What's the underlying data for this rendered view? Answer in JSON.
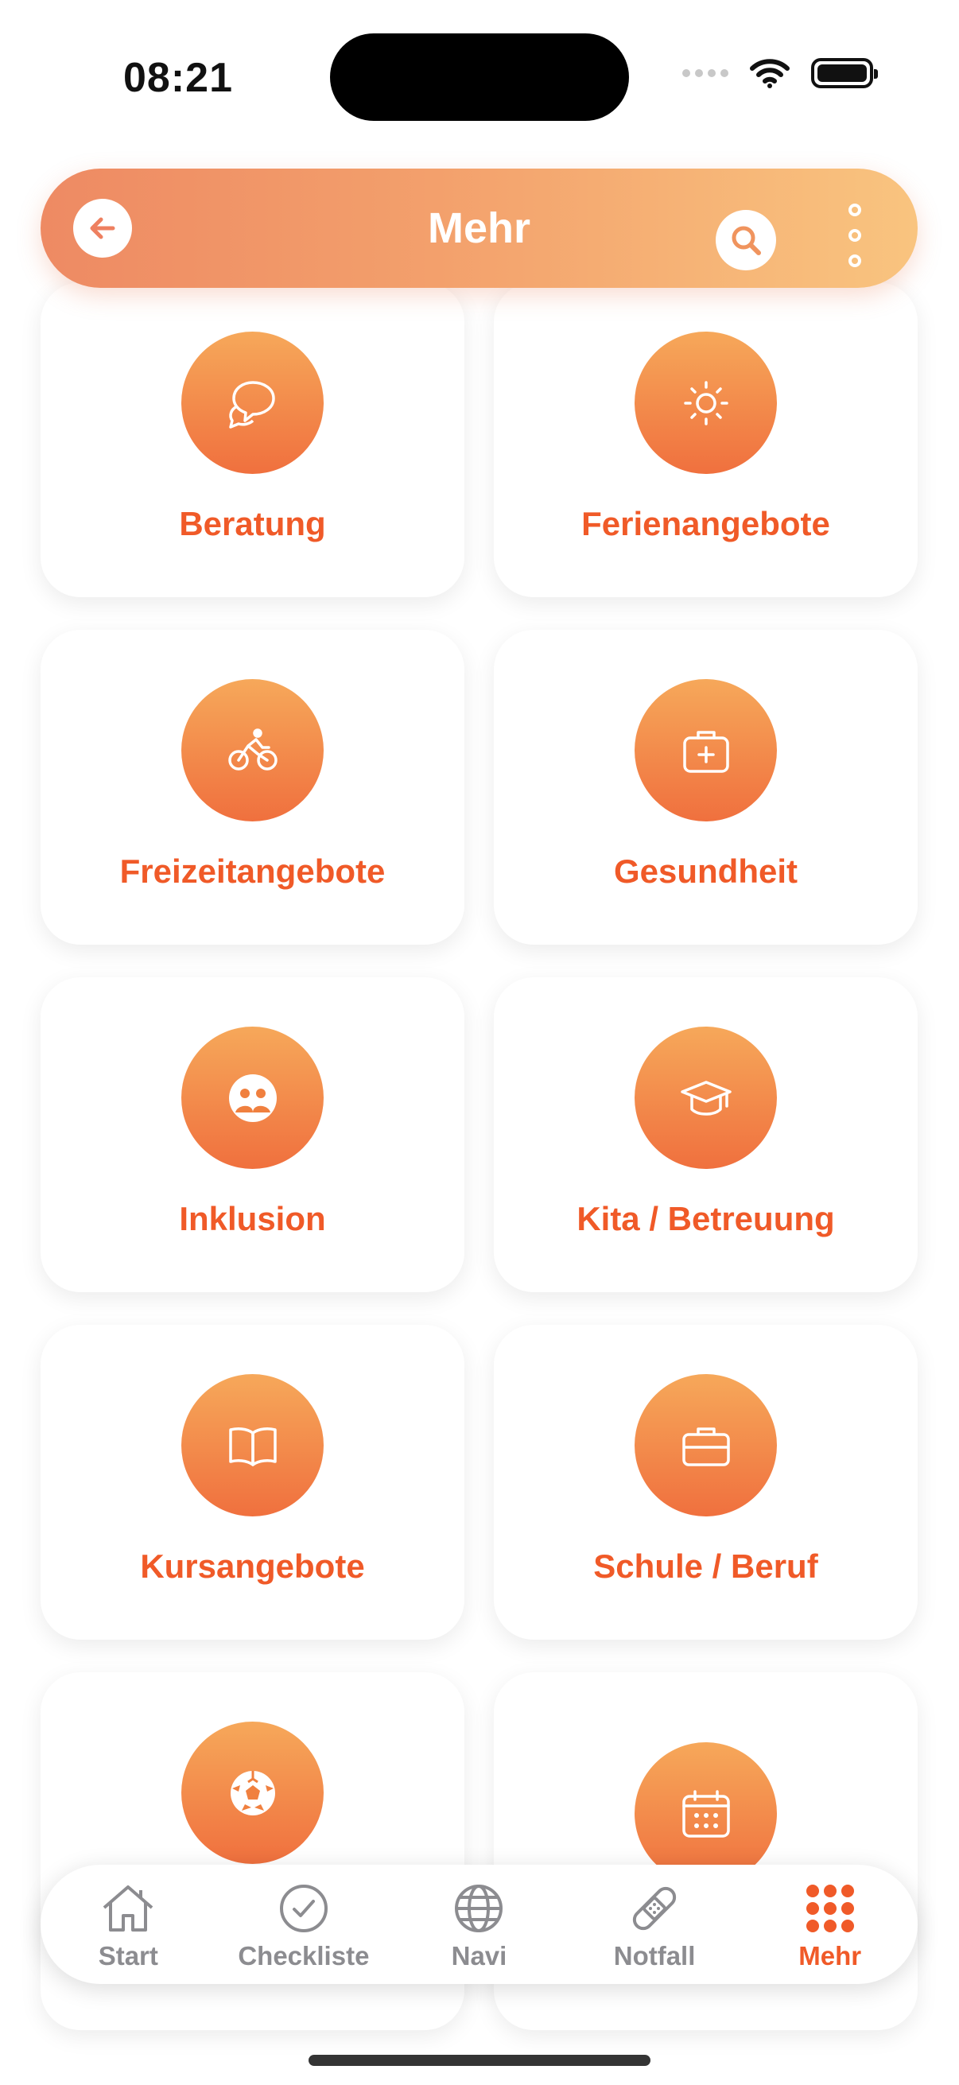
{
  "status_bar": {
    "time": "08:21"
  },
  "header": {
    "title": "Mehr"
  },
  "tiles": [
    {
      "label": "Beratung",
      "icon": "chat-bubbles-icon"
    },
    {
      "label": "Ferienangebote",
      "icon": "sun-icon"
    },
    {
      "label": "Freizeitangebote",
      "icon": "bicycle-icon"
    },
    {
      "label": "Gesundheit",
      "icon": "first-aid-kit-icon"
    },
    {
      "label": "Inklusion",
      "icon": "people-circle-icon"
    },
    {
      "label": "Kita / Betreuung",
      "icon": "graduation-cap-icon"
    },
    {
      "label": "Kursangebote",
      "icon": "open-book-icon"
    },
    {
      "label": "Schule / Beruf",
      "icon": "briefcase-icon"
    },
    {
      "label": "",
      "icon": "soccer-ball-icon"
    },
    {
      "label": "",
      "icon": "calendar-icon"
    }
  ],
  "tabbar": {
    "items": [
      {
        "label": "Start",
        "icon": "home-icon",
        "active": false
      },
      {
        "label": "Checkliste",
        "icon": "checkmark-circle-icon",
        "active": false
      },
      {
        "label": "Navi",
        "icon": "globe-icon",
        "active": false
      },
      {
        "label": "Notfall",
        "icon": "bandage-icon",
        "active": false
      },
      {
        "label": "Mehr",
        "icon": "grid-dots-icon",
        "active": true
      }
    ]
  },
  "colors": {
    "accent": "#f05a28",
    "header_gradient_start": "#ee8a63",
    "header_gradient_end": "#f9c47f",
    "circle_gradient_top": "#f6a85a",
    "circle_gradient_bottom": "#f0703e",
    "inactive_tab": "#8c8c90"
  }
}
